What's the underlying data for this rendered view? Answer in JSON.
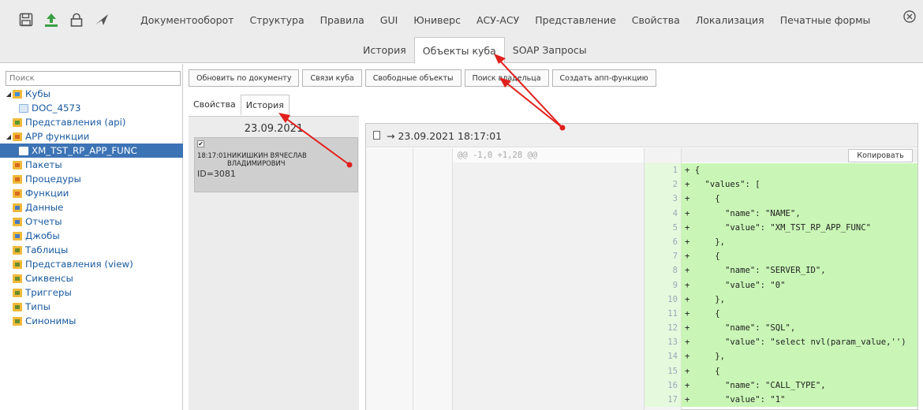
{
  "top_menu": [
    "Документооборот",
    "Структура",
    "Правила",
    "GUI",
    "Юниверс",
    "АСУ-АСУ",
    "Представление",
    "Свойства",
    "Локализация",
    "Печатные формы"
  ],
  "sub_tabs": [
    {
      "label": "История",
      "active": false
    },
    {
      "label": "Объекты куба",
      "active": true
    },
    {
      "label": "SOAP Запросы",
      "active": false
    }
  ],
  "sidebar": {
    "search_placeholder": "Поиск",
    "tree": [
      {
        "label": "Кубы",
        "level": 0,
        "expanded": true,
        "icon": "cube-folder-icon"
      },
      {
        "label": "DOC_4573",
        "level": 1,
        "icon": "doc-icon"
      },
      {
        "label": "Представления (api)",
        "level": 0,
        "icon": "view-folder-icon"
      },
      {
        "label": "APP функции",
        "level": 0,
        "expanded": true,
        "icon": "app-folder-icon"
      },
      {
        "label": "XM_TST_RP_APP_FUNC",
        "level": 1,
        "selected": true,
        "icon": "file-icon"
      },
      {
        "label": "Пакеты",
        "level": 0,
        "icon": "package-folder-icon"
      },
      {
        "label": "Процедуры",
        "level": 0,
        "icon": "procedure-folder-icon"
      },
      {
        "label": "Функции",
        "level": 0,
        "icon": "function-folder-icon"
      },
      {
        "label": "Данные",
        "level": 0,
        "icon": "data-folder-icon"
      },
      {
        "label": "Отчеты",
        "level": 0,
        "icon": "report-folder-icon"
      },
      {
        "label": "Джобы",
        "level": 0,
        "icon": "job-folder-icon"
      },
      {
        "label": "Таблицы",
        "level": 0,
        "icon": "table-folder-icon"
      },
      {
        "label": "Представления (view)",
        "level": 0,
        "icon": "view-folder-icon"
      },
      {
        "label": "Сиквенсы",
        "level": 0,
        "icon": "sequence-folder-icon"
      },
      {
        "label": "Триггеры",
        "level": 0,
        "icon": "trigger-folder-icon"
      },
      {
        "label": "Типы",
        "level": 0,
        "icon": "type-folder-icon"
      },
      {
        "label": "Синонимы",
        "level": 0,
        "icon": "synonym-folder-icon"
      }
    ]
  },
  "toolbar": [
    "Обновить по документу",
    "Связи куба",
    "Свободные объекты",
    "Поиск владельца",
    "Создать апп-функцию"
  ],
  "inner_tabs": [
    {
      "label": "Свойства",
      "active": false
    },
    {
      "label": "История",
      "active": true
    }
  ],
  "history": {
    "date": "23.09.2021",
    "entry": {
      "checked": true,
      "time": "18:17:01",
      "author_line1": "НИКИШКИН ВЯЧЕСЛАВ",
      "author_line2": "ВЛАДИМИРОВИЧ",
      "id": "ID=3081"
    }
  },
  "diff": {
    "header": "→ 23.09.2021 18:17:01",
    "hunk": "@@ -1,0 +1,28 @@",
    "copy_label": "Копировать",
    "lines": [
      {
        "n": "1",
        "t": "+ {"
      },
      {
        "n": "2",
        "t": "+   \"values\": ["
      },
      {
        "n": "3",
        "t": "+     {"
      },
      {
        "n": "4",
        "t": "+       \"name\": \"NAME\","
      },
      {
        "n": "5",
        "t": "+       \"value\": \"XM_TST_RP_APP_FUNC\""
      },
      {
        "n": "6",
        "t": "+     },"
      },
      {
        "n": "7",
        "t": "+     {"
      },
      {
        "n": "8",
        "t": "+       \"name\": \"SERVER_ID\","
      },
      {
        "n": "9",
        "t": "+       \"value\": \"0\""
      },
      {
        "n": "10",
        "t": "+     },"
      },
      {
        "n": "11",
        "t": "+     {"
      },
      {
        "n": "12",
        "t": "+       \"name\": \"SQL\","
      },
      {
        "n": "13",
        "t": "+       \"value\": \"select nvl(param_value,'')"
      },
      {
        "n": "14",
        "t": "+     },"
      },
      {
        "n": "15",
        "t": "+     {"
      },
      {
        "n": "16",
        "t": "+       \"name\": \"CALL_TYPE\","
      },
      {
        "n": "17",
        "t": "+       \"value\": \"1\""
      }
    ]
  },
  "colors": {
    "accent": "#3c73b5",
    "annotation": "#e0201c",
    "added_line": "#c9f6b6"
  }
}
